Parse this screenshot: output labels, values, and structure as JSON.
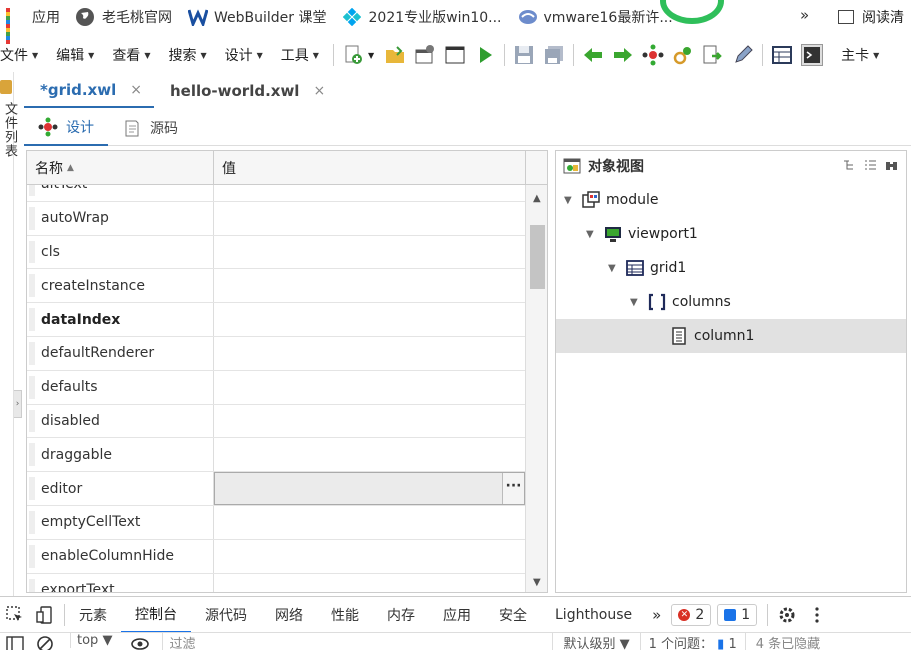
{
  "bookmarks": {
    "items": [
      {
        "label": "应用",
        "icon": "apps-icon"
      },
      {
        "label": "老毛桃官网",
        "icon": "globe-icon"
      },
      {
        "label": "WebBuilder 课堂",
        "icon": "webbuilder-icon"
      },
      {
        "label": "2021专业版win10...",
        "icon": "windows-diamond-icon"
      },
      {
        "label": "vmware16最新许...",
        "icon": "vmware-icon"
      }
    ],
    "more": "»",
    "reading_list": "阅读清"
  },
  "menubar": {
    "menus": [
      "文件",
      "编辑",
      "查看",
      "搜索",
      "设计",
      "工具"
    ],
    "right_menu": "主卡"
  },
  "sidebar": {
    "label": "文件列表"
  },
  "file_tabs": [
    {
      "label": "*grid.xwl",
      "close": "×",
      "active": true
    },
    {
      "label": "hello-world.xwl",
      "close": "×",
      "active": false
    }
  ],
  "view_tabs": [
    {
      "label": "设计",
      "icon": "design-icon",
      "active": true
    },
    {
      "label": "源码",
      "icon": "source-icon",
      "active": false
    }
  ],
  "property_grid": {
    "name_header": "名称",
    "value_header": "值",
    "rows": [
      {
        "name": "altText",
        "bold": false
      },
      {
        "name": "autoWrap",
        "bold": false
      },
      {
        "name": "cls",
        "bold": false
      },
      {
        "name": "createInstance",
        "bold": false
      },
      {
        "name": "dataIndex",
        "bold": true
      },
      {
        "name": "defaultRenderer",
        "bold": false
      },
      {
        "name": "defaults",
        "bold": false
      },
      {
        "name": "disabled",
        "bold": false
      },
      {
        "name": "draggable",
        "bold": false
      },
      {
        "name": "editor",
        "bold": false,
        "selected": true
      },
      {
        "name": "emptyCellText",
        "bold": false
      },
      {
        "name": "enableColumnHide",
        "bold": false
      },
      {
        "name": "exportText",
        "bold": false
      }
    ],
    "ellipsis": "···"
  },
  "object_view": {
    "title": "对象视图",
    "tree": [
      {
        "label": "module",
        "icon": "module-icon",
        "depth": 0,
        "expanded": true
      },
      {
        "label": "viewport1",
        "icon": "viewport-icon",
        "depth": 1,
        "expanded": true
      },
      {
        "label": "grid1",
        "icon": "grid-icon",
        "depth": 2,
        "expanded": true
      },
      {
        "label": "columns",
        "icon": "array-icon",
        "depth": 3,
        "expanded": true
      },
      {
        "label": "column1",
        "icon": "column-icon",
        "depth": 4,
        "expanded": false,
        "selected": true
      }
    ]
  },
  "devtools": {
    "tabs": [
      "元素",
      "控制台",
      "源代码",
      "网络",
      "性能",
      "内存",
      "应用",
      "安全",
      "Lighthouse"
    ],
    "active_tab": "控制台",
    "more": "»",
    "error_count": "2",
    "message_count": "1"
  },
  "console": {
    "context": "top",
    "filter_placeholder": "过滤",
    "level": "默认级别",
    "issues": "1 个问题：",
    "issue_count": "1",
    "hidden": "4 条已隐藏"
  },
  "colors": {
    "accent": "#2b6cb0",
    "tree_selected": "#e1e1e1",
    "devtools_active": "#1a73e8"
  }
}
